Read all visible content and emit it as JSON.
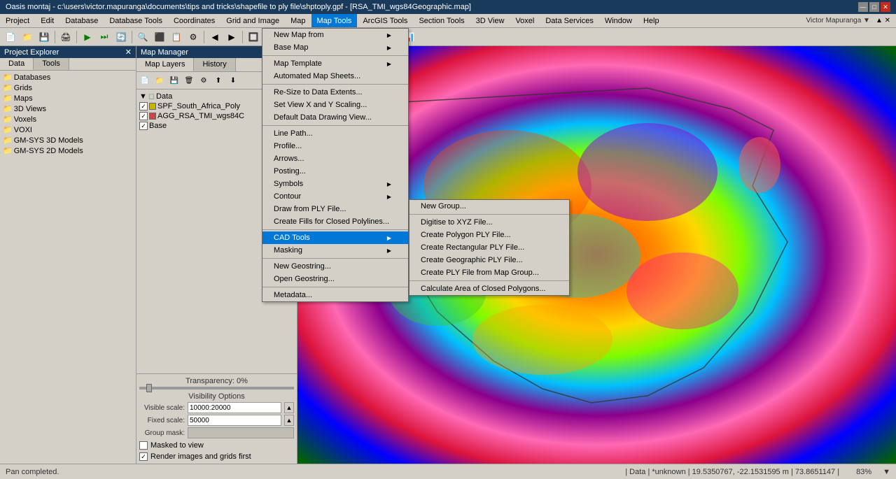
{
  "titleBar": {
    "title": "Oasis montaj - c:\\users\\victor.mapuranga\\documents\\tips and tricks\\shapefile to ply file\\shptoply.gpf - [RSA_TMI_wgs84Geographic.map]",
    "controls": [
      "—",
      "□",
      "✕"
    ]
  },
  "menuBar": {
    "items": [
      "Project",
      "Edit",
      "Database",
      "Database Tools",
      "Coordinates",
      "Grid and Image",
      "Map",
      "Map Tools",
      "ArcGIS Tools",
      "Section Tools",
      "3D View",
      "Voxel",
      "Data Services",
      "Window",
      "Help"
    ],
    "activeItem": "Map Tools"
  },
  "toolbar": {
    "buttons": [
      "📁",
      "💾",
      "🖨",
      "▶",
      "⏭",
      "🔄",
      "📋"
    ]
  },
  "projectExplorer": {
    "title": "Project Explorer",
    "items": [
      {
        "label": "Databases",
        "indent": 0,
        "icon": "🗄"
      },
      {
        "label": "Grids",
        "indent": 0,
        "icon": "📊"
      },
      {
        "label": "Maps",
        "indent": 0,
        "icon": "🗺"
      },
      {
        "label": "3D Views",
        "indent": 0,
        "icon": "📐"
      },
      {
        "label": "Voxels",
        "indent": 0,
        "icon": "📦"
      },
      {
        "label": "VOXI",
        "indent": 0,
        "icon": "🔷"
      },
      {
        "label": "GM-SYS 3D Models",
        "indent": 0,
        "icon": "📋"
      },
      {
        "label": "GM-SYS 2D Models",
        "indent": 0,
        "icon": "📋"
      }
    ]
  },
  "mapManager": {
    "title": "Map Manager",
    "tabs": [
      "Map Layers",
      "History"
    ],
    "activeTab": "Map Layers",
    "layers": [
      {
        "label": "Data",
        "indent": 0,
        "hasCheckbox": false,
        "expanded": true
      },
      {
        "label": "SPF_South_Africa_Poly",
        "indent": 1,
        "hasCheckbox": true,
        "checked": true,
        "colorIcon": "yellow"
      },
      {
        "label": "AGG_RSA_TMI_wgs84C",
        "indent": 1,
        "hasCheckbox": true,
        "checked": true,
        "colorIcon": "red"
      },
      {
        "label": "Base",
        "indent": 1,
        "hasCheckbox": true,
        "checked": true
      }
    ]
  },
  "visibilityOptions": {
    "title": "Transparency: 0%",
    "visibilityTitle": "Visibility Options",
    "visibleScaleLabel": "Visible scale:",
    "visibleScaleValue": "10000:20000",
    "fixedScaleLabel": "Fixed scale:",
    "fixedScaleValue": "50000",
    "groupMaskLabel": "Group mask:",
    "groupMaskValue": "",
    "maskedToView": "Masked to view",
    "renderImagesLabel": "Render images and grids first"
  },
  "mapToolsMenu": {
    "items": [
      {
        "label": "New Map from",
        "hasSubmenu": true
      },
      {
        "label": "Base Map",
        "hasSubmenu": true
      },
      {
        "divider": true
      },
      {
        "label": "Map Template",
        "hasSubmenu": true
      },
      {
        "label": "Automated Map Sheets...",
        "hasSubmenu": false
      },
      {
        "divider": true
      },
      {
        "label": "Re-Size to Data Extents...",
        "hasSubmenu": false
      },
      {
        "label": "Set View X and Y Scaling...",
        "hasSubmenu": false
      },
      {
        "label": "Default Data Drawing View...",
        "hasSubmenu": false
      },
      {
        "divider": true
      },
      {
        "label": "Line Path...",
        "hasSubmenu": false
      },
      {
        "label": "Profile...",
        "hasSubmenu": false
      },
      {
        "label": "Arrows...",
        "hasSubmenu": false
      },
      {
        "label": "Posting...",
        "hasSubmenu": false
      },
      {
        "label": "Symbols",
        "hasSubmenu": true
      },
      {
        "label": "Contour",
        "hasSubmenu": true
      },
      {
        "label": "Draw from PLY File...",
        "hasSubmenu": false
      },
      {
        "label": "Create Fills for Closed Polylines...",
        "hasSubmenu": false
      },
      {
        "divider": true
      },
      {
        "label": "CAD Tools",
        "hasSubmenu": true,
        "highlighted": true
      },
      {
        "label": "Masking",
        "hasSubmenu": true
      },
      {
        "divider": true
      },
      {
        "label": "New Geostring...",
        "hasSubmenu": false
      },
      {
        "label": "Open Geostring...",
        "hasSubmenu": false
      },
      {
        "divider": true
      },
      {
        "label": "Metadata...",
        "hasSubmenu": false
      }
    ]
  },
  "cadToolsSubmenu": {
    "items": [
      {
        "label": "New Group...",
        "hasSubmenu": false
      },
      {
        "divider": true
      },
      {
        "label": "Digitise to XYZ File...",
        "hasSubmenu": false
      },
      {
        "label": "Create Polygon PLY File...",
        "hasSubmenu": false
      },
      {
        "label": "Create Rectangular PLY File...",
        "hasSubmenu": false
      },
      {
        "label": "Create Geographic PLY File...",
        "hasSubmenu": false
      },
      {
        "label": "Create PLY File from Map Group...",
        "hasSubmenu": false
      },
      {
        "divider": true
      },
      {
        "label": "Calculate Area of Closed Polygons...",
        "hasSubmenu": false
      }
    ]
  },
  "statusBar": {
    "left": "Pan completed.",
    "right": "| Data | *unknown | 19.5350767, -22.1531595 m | 73.8651147 | 83% ▼"
  },
  "colors": {
    "titleBg": "#1a3a5c",
    "menuActiveBg": "#0078d7",
    "highlightedMenu": "#0078d7"
  }
}
